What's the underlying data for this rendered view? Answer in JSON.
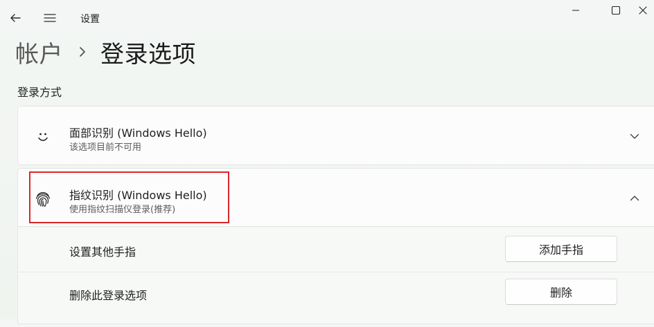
{
  "window": {
    "app_title": "设置",
    "back_icon": "back-arrow-icon",
    "menu_icon": "hamburger-menu-icon"
  },
  "breadcrumb": {
    "parent": "帐户",
    "separator_icon": "chevron-right-icon",
    "current": "登录选项"
  },
  "section": {
    "label": "登录方式"
  },
  "face": {
    "title": "面部识别 (Windows Hello)",
    "subtitle": "该选项目前不可用",
    "icon": "smiley-face-icon",
    "expanded": false
  },
  "fingerprint": {
    "title": "指纹识别 (Windows Hello)",
    "subtitle": "使用指纹扫描仪登录(推荐)",
    "icon": "fingerprint-icon",
    "expanded": true,
    "rows": [
      {
        "label": "设置其他手指",
        "button": "添加手指"
      },
      {
        "label": "删除此登录选项",
        "button": "删除"
      }
    ]
  },
  "colors": {
    "highlight": "#d9262b",
    "background": "#f1f5f1"
  }
}
